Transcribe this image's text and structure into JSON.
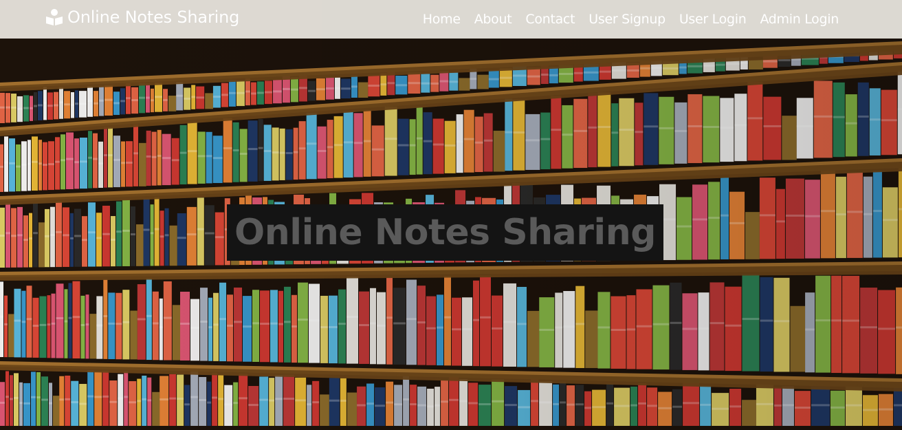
{
  "navbar": {
    "brand_icon": "book-reader-icon",
    "brand_text": "Online Notes Sharing",
    "links": [
      {
        "label": "Home"
      },
      {
        "label": "About"
      },
      {
        "label": "Contact"
      },
      {
        "label": "User Signup"
      },
      {
        "label": "User Login"
      },
      {
        "label": "Admin Login"
      }
    ]
  },
  "hero": {
    "image": "library-bookshelves-photo",
    "headline": "Online Notes Sharing"
  },
  "colors": {
    "navbar_bg": "#ece8e2",
    "nav_text": "#ffffff",
    "headline_bg": "#141414",
    "headline_text": "#5a5a5a",
    "shelf": "#a8742f"
  }
}
